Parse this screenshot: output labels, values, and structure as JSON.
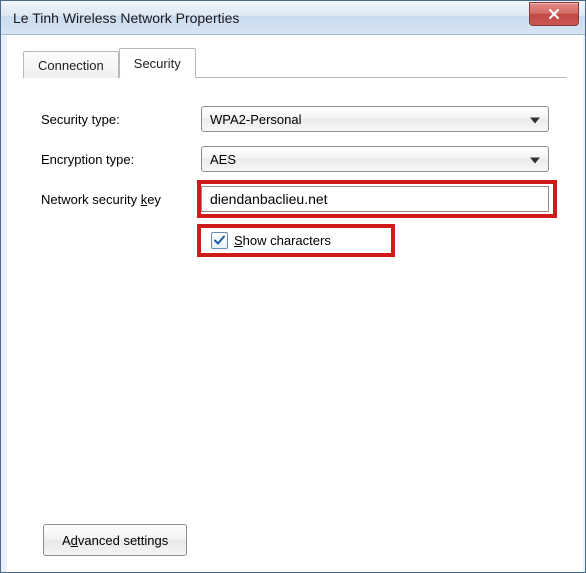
{
  "window": {
    "title": "Le Tinh Wireless Network Properties"
  },
  "tabs": {
    "connection": "Connection",
    "security": "Security",
    "active": "security"
  },
  "form": {
    "security_type_label": "Security type:",
    "security_type_value": "WPA2-Personal",
    "encryption_type_label": "Encryption type:",
    "encryption_type_value": "AES",
    "network_key_label_pre": "Network security ",
    "network_key_label_u": "k",
    "network_key_label_post": "ey",
    "network_key_value": "diendanbaclieu.net",
    "show_chars_pre": "",
    "show_chars_u": "S",
    "show_chars_post": "how characters",
    "show_chars_checked": true
  },
  "buttons": {
    "advanced_pre": "A",
    "advanced_u": "d",
    "advanced_post": "vanced settings"
  },
  "glyphs": {
    "close": "✕",
    "chevron_down": "▾",
    "check": "✓"
  },
  "highlights": {
    "key_box": "#d01a1a",
    "show_box": "#d01a1a"
  }
}
